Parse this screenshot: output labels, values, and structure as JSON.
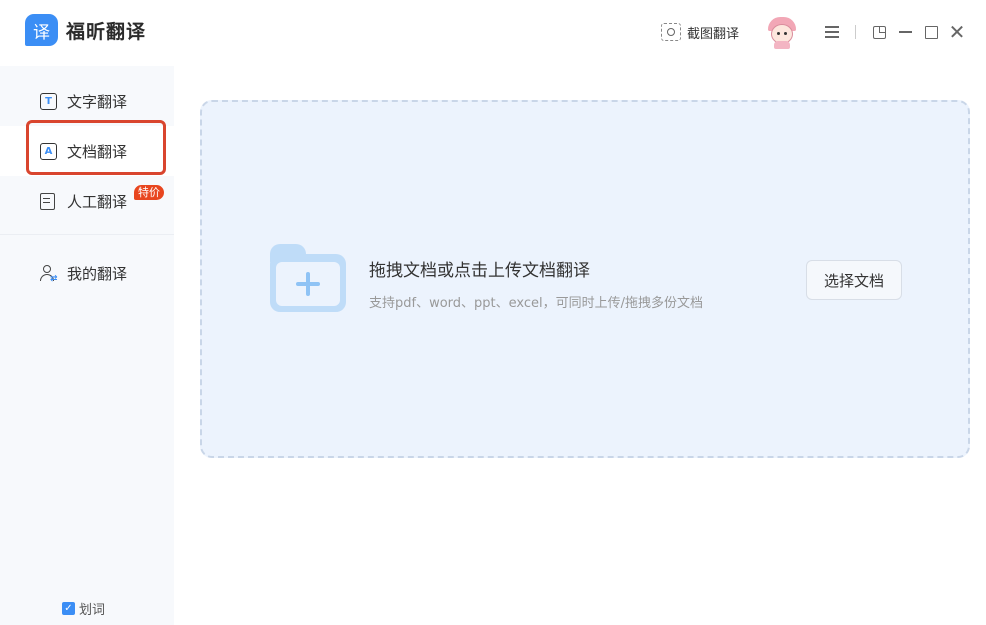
{
  "app": {
    "logo_char": "译",
    "name": "福昕翻译"
  },
  "toolbar": {
    "capture_label": "截图翻译"
  },
  "sidebar": {
    "items": [
      {
        "label": "文字翻译",
        "icon": "text-translate-icon",
        "active": false
      },
      {
        "label": "文档翻译",
        "icon": "doc-translate-icon",
        "active": true
      },
      {
        "label": "人工翻译",
        "icon": "human-translate-icon",
        "badge": "特价",
        "active": false
      },
      {
        "label": "我的翻译",
        "icon": "my-translations-icon",
        "active": false
      }
    ],
    "word_select_label": "划词",
    "word_select_checked": true
  },
  "main": {
    "drop_title": "拖拽文档或点击上传文档翻译",
    "drop_subtitle": "支持pdf、word、ppt、excel，可同时上传/拖拽多份文档",
    "select_button": "选择文档"
  },
  "colors": {
    "accent": "#3b8ef5",
    "highlight": "#d9452e",
    "badge": "#e8461f",
    "dropzone_bg": "#ecf3fd"
  }
}
